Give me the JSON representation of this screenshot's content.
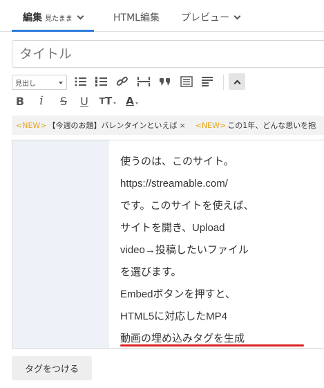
{
  "tabs": {
    "edit": {
      "label": "編集",
      "sublabel": "見たまま"
    },
    "html": {
      "label": "HTML編集"
    },
    "preview": {
      "label": "プレビュー"
    }
  },
  "title": {
    "placeholder": "タイトル",
    "value": ""
  },
  "toolbar": {
    "heading_select": "見出し",
    "icons": [
      "bullet-list-icon",
      "numbered-list-icon",
      "link-icon",
      "page-break-icon",
      "quote-icon",
      "table-of-contents-icon",
      "align-icon",
      "collapse-up-icon"
    ],
    "format": {
      "bold": "B",
      "italic": "i",
      "strike": "S",
      "underline": "U",
      "fontsize": "T",
      "color": "A"
    }
  },
  "topics": [
    {
      "badge": "<NEW>",
      "text": "【今週のお題】バレンタインといえば",
      "close": "×"
    },
    {
      "badge": "<NEW>",
      "text": "この1年、どんな思いを抱"
    }
  ],
  "editor": {
    "lines": [
      "使うのは、このサイト。",
      "https://streamable.com/",
      "です。このサイトを使えば、",
      "サイトを開き、Upload",
      "video→投稿したいファイル",
      "を選びます。",
      "Embedボタンを押すと、",
      "HTML5に対応したMP4",
      "動画の埋め込みタグを生成"
    ]
  },
  "tag_button": {
    "label": "タグをつける"
  },
  "colors": {
    "accent": "#2b7bd9",
    "new_badge": "#e8a317",
    "highlight": "#e02020",
    "gutter": "#eef1f7"
  }
}
